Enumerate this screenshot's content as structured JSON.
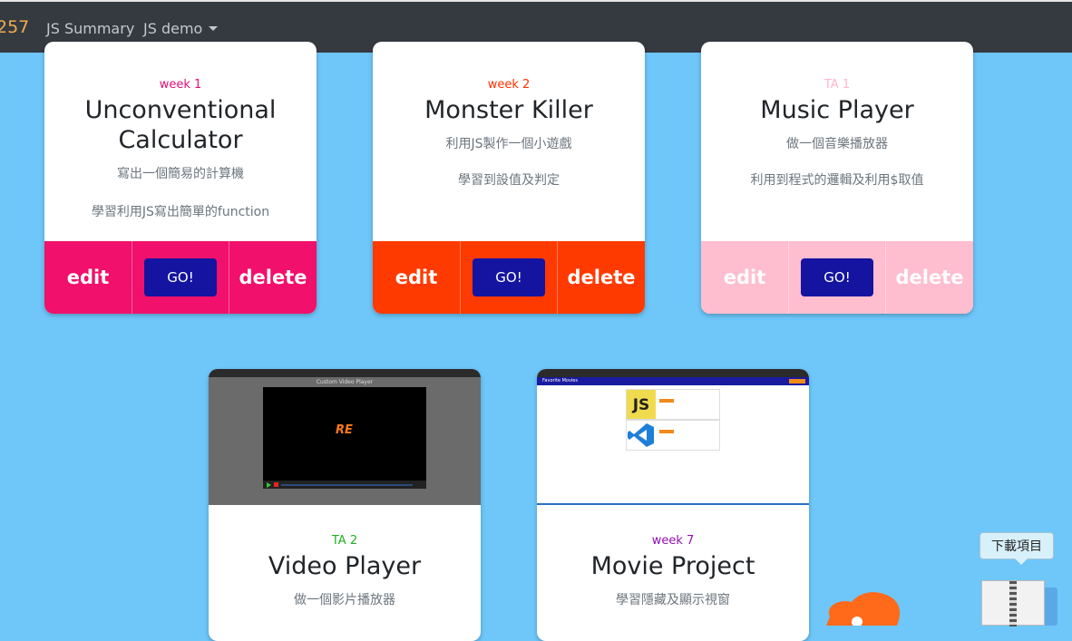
{
  "nav": {
    "brand": "257",
    "links": [
      {
        "label": "JS Summary"
      },
      {
        "label": "JS demo"
      }
    ]
  },
  "cards": [
    {
      "week": "week 1",
      "week_color": "#e0107a",
      "title": "Unconventional Calculator",
      "desc": "寫出一個簡易的計算機",
      "desc2": "學習利用JS寫出簡單的function",
      "bar_color": "#f1106c",
      "edit": "edit",
      "go": "GO!",
      "delete": "delete"
    },
    {
      "week": "week 2",
      "week_color": "#ff3000",
      "title": "Monster Killer",
      "desc": "利用JS製作一個小遊戲",
      "desc2": "學習到設值及判定",
      "bar_color": "#ff3a00",
      "edit": "edit",
      "go": "GO!",
      "delete": "delete"
    },
    {
      "week": "TA 1",
      "week_color": "#ffb6c8",
      "title": "Music Player",
      "desc": "做一個音樂播放器",
      "desc2": "利用到程式的邏輯及利用$取值",
      "bar_color": "#ffbdd0",
      "edit": "edit",
      "go": "GO!",
      "delete": "delete"
    },
    {
      "week": "TA 2",
      "week_color": "#20b020",
      "title": "Video Player",
      "desc": "做一個影片播放器",
      "shot_title": "Custom Video Player"
    },
    {
      "week": "week 7",
      "week_color": "#9010b0",
      "title": "Movie Project",
      "desc": "學習隱藏及顯示視窗",
      "shot_title": "Favorite Movies"
    }
  ],
  "download": {
    "label": "下載項目"
  },
  "icons": [
    "caret-down-icon",
    "download-stack-icon",
    "zip-file-icon",
    "mascot-blob-icon",
    "js-logo-icon",
    "vscode-logo-icon",
    "play-icon"
  ]
}
